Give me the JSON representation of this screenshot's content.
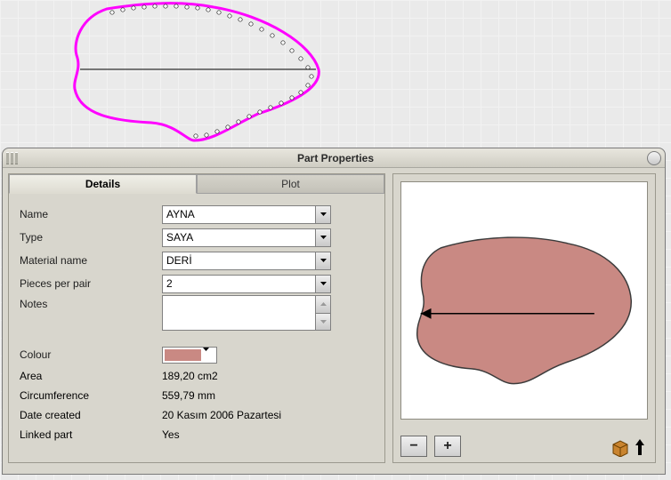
{
  "dialog": {
    "title": "Part Properties",
    "tabs": {
      "details": "Details",
      "plot": "Plot"
    }
  },
  "fields": {
    "name_label": "Name",
    "name_value": "AYNA",
    "type_label": "Type",
    "type_value": "SAYA",
    "material_label": "Material name",
    "material_value": "DERİ",
    "pieces_label": "Pieces per pair",
    "pieces_value": "2",
    "notes_label": "Notes",
    "notes_value": "",
    "colour_label": "Colour",
    "colour_hex": "#c98983",
    "area_label": "Area",
    "area_value": "189,20 cm2",
    "circ_label": "Circumference",
    "circ_value": "559,79 mm",
    "date_label": "Date created",
    "date_value": "20 Kasım 2006 Pazartesi",
    "linked_label": "Linked part",
    "linked_value": "Yes"
  },
  "preview": {
    "zoom_out": "−",
    "zoom_in": "+"
  },
  "colors": {
    "outline_magenta": "#ff00ff",
    "fill_pink": "#c98983",
    "shape_stroke": "#3b3b3b"
  }
}
